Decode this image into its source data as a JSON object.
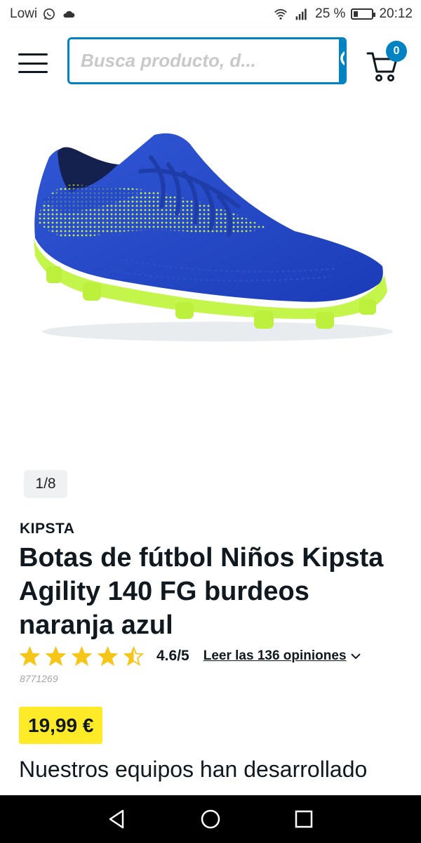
{
  "status_bar": {
    "carrier": "Lowi",
    "battery": "25 %",
    "battery_level": 0.25,
    "time": "20:12"
  },
  "header": {
    "search_placeholder": "Busca producto, d...",
    "cart_count": "0",
    "accent_color": "#0082c3"
  },
  "gallery": {
    "counter": "1/8"
  },
  "product": {
    "brand": "KIPSTA",
    "title": "Botas de fútbol Niños Kipsta Agility 140 FG burdeos naranja azul",
    "rating_value": 4.6,
    "rating_text": "4.6/5",
    "reviews_link": "Leer las 136 opiniones",
    "sku": "8771269",
    "price": "19,99 €",
    "price_color": "#ffea28",
    "description_start": "Nuestros equipos han desarrollado"
  },
  "icons": [
    "whatsapp-icon",
    "cloud-icon",
    "wifi-icon",
    "signal-icon",
    "battery-icon",
    "menu-icon",
    "search-icon",
    "cart-icon",
    "star-icon",
    "chevron-down-icon",
    "back-icon",
    "home-icon",
    "recents-icon"
  ]
}
